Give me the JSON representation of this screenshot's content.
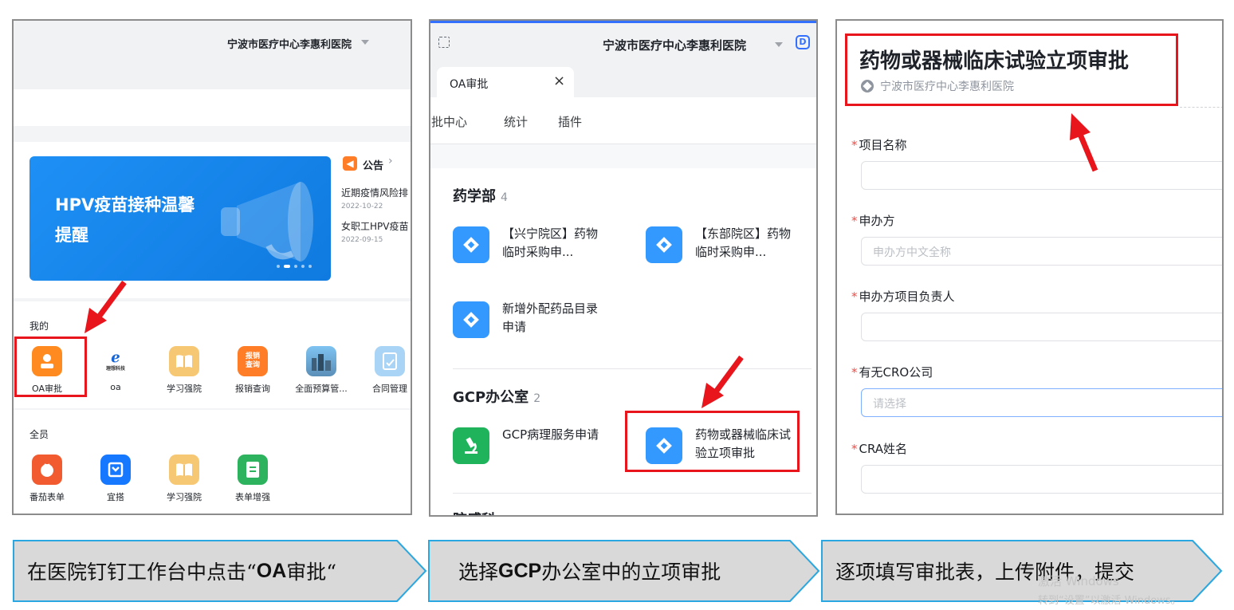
{
  "panel1": {
    "hospital": "宁波市医疗中心李惠利医院",
    "banner_title": "HPV疫苗接种温馨\n提醒",
    "notice_title": "公告",
    "notices": [
      {
        "text": "近期疫情风险排",
        "date": "2022-10-22"
      },
      {
        "text": "女职工HPV疫苗",
        "date": "2022-09-15"
      }
    ],
    "mine_label": "我的",
    "mine_apps": [
      "OA审批",
      "oa",
      "学习强院",
      "报销查询",
      "全面预算管...",
      "合同管理"
    ],
    "oa_brand": "理想科技",
    "baoxiao_icon_text": "报销\n查询",
    "all_label": "全员",
    "all_apps": [
      "番茄表单",
      "宜搭",
      "学习强院",
      "表单增强"
    ]
  },
  "panel2": {
    "hospital": "宁波市医疗中心李惠利医院",
    "tab_label": "OA审批",
    "tab_close": "×",
    "nav": [
      "审批中心",
      "统计",
      "插件"
    ],
    "groups": [
      {
        "name": "药学部",
        "count": "4",
        "items": [
          "【兴宁院区】药物临时采购申...",
          "【东部院区】药物临时采购申...",
          "新增外配药品目录申请"
        ]
      },
      {
        "name": "GCP办公室",
        "count": "2",
        "items": [
          "GCP病理服务申请",
          "药物或器械临床试验立项审批"
        ]
      }
    ],
    "next_group_partial": "院感科"
  },
  "panel3": {
    "title": "药物或器械临床试验立项审批",
    "org": "宁波市医疗中心李惠利医院",
    "fields": [
      {
        "label": "项目名称",
        "placeholder": ""
      },
      {
        "label": "申办方",
        "placeholder": "申办方中文全称"
      },
      {
        "label": "申办方项目负责人",
        "placeholder": ""
      },
      {
        "label": "有无CRO公司",
        "placeholder": "请选择"
      },
      {
        "label": "CRA姓名",
        "placeholder": ""
      }
    ]
  },
  "steps": [
    {
      "pre": "在医院钉钉工作台中点击“",
      "bold": "OA",
      "post": "审批“"
    },
    {
      "pre": "选择",
      "bold": "GCP",
      "post": "办公室中的立项审批"
    },
    {
      "pre": "逐项填写审批表，上传附件，提交",
      "bold": "",
      "post": ""
    }
  ],
  "watermark": {
    "line1": "激活 Windows",
    "line2": "转到“设置”以激活 Windows。"
  },
  "colors": {
    "accent": "#3370ff",
    "highlight": "#e8161c",
    "step_fill": "#d9d9d9",
    "step_border": "#2aa7e0"
  }
}
